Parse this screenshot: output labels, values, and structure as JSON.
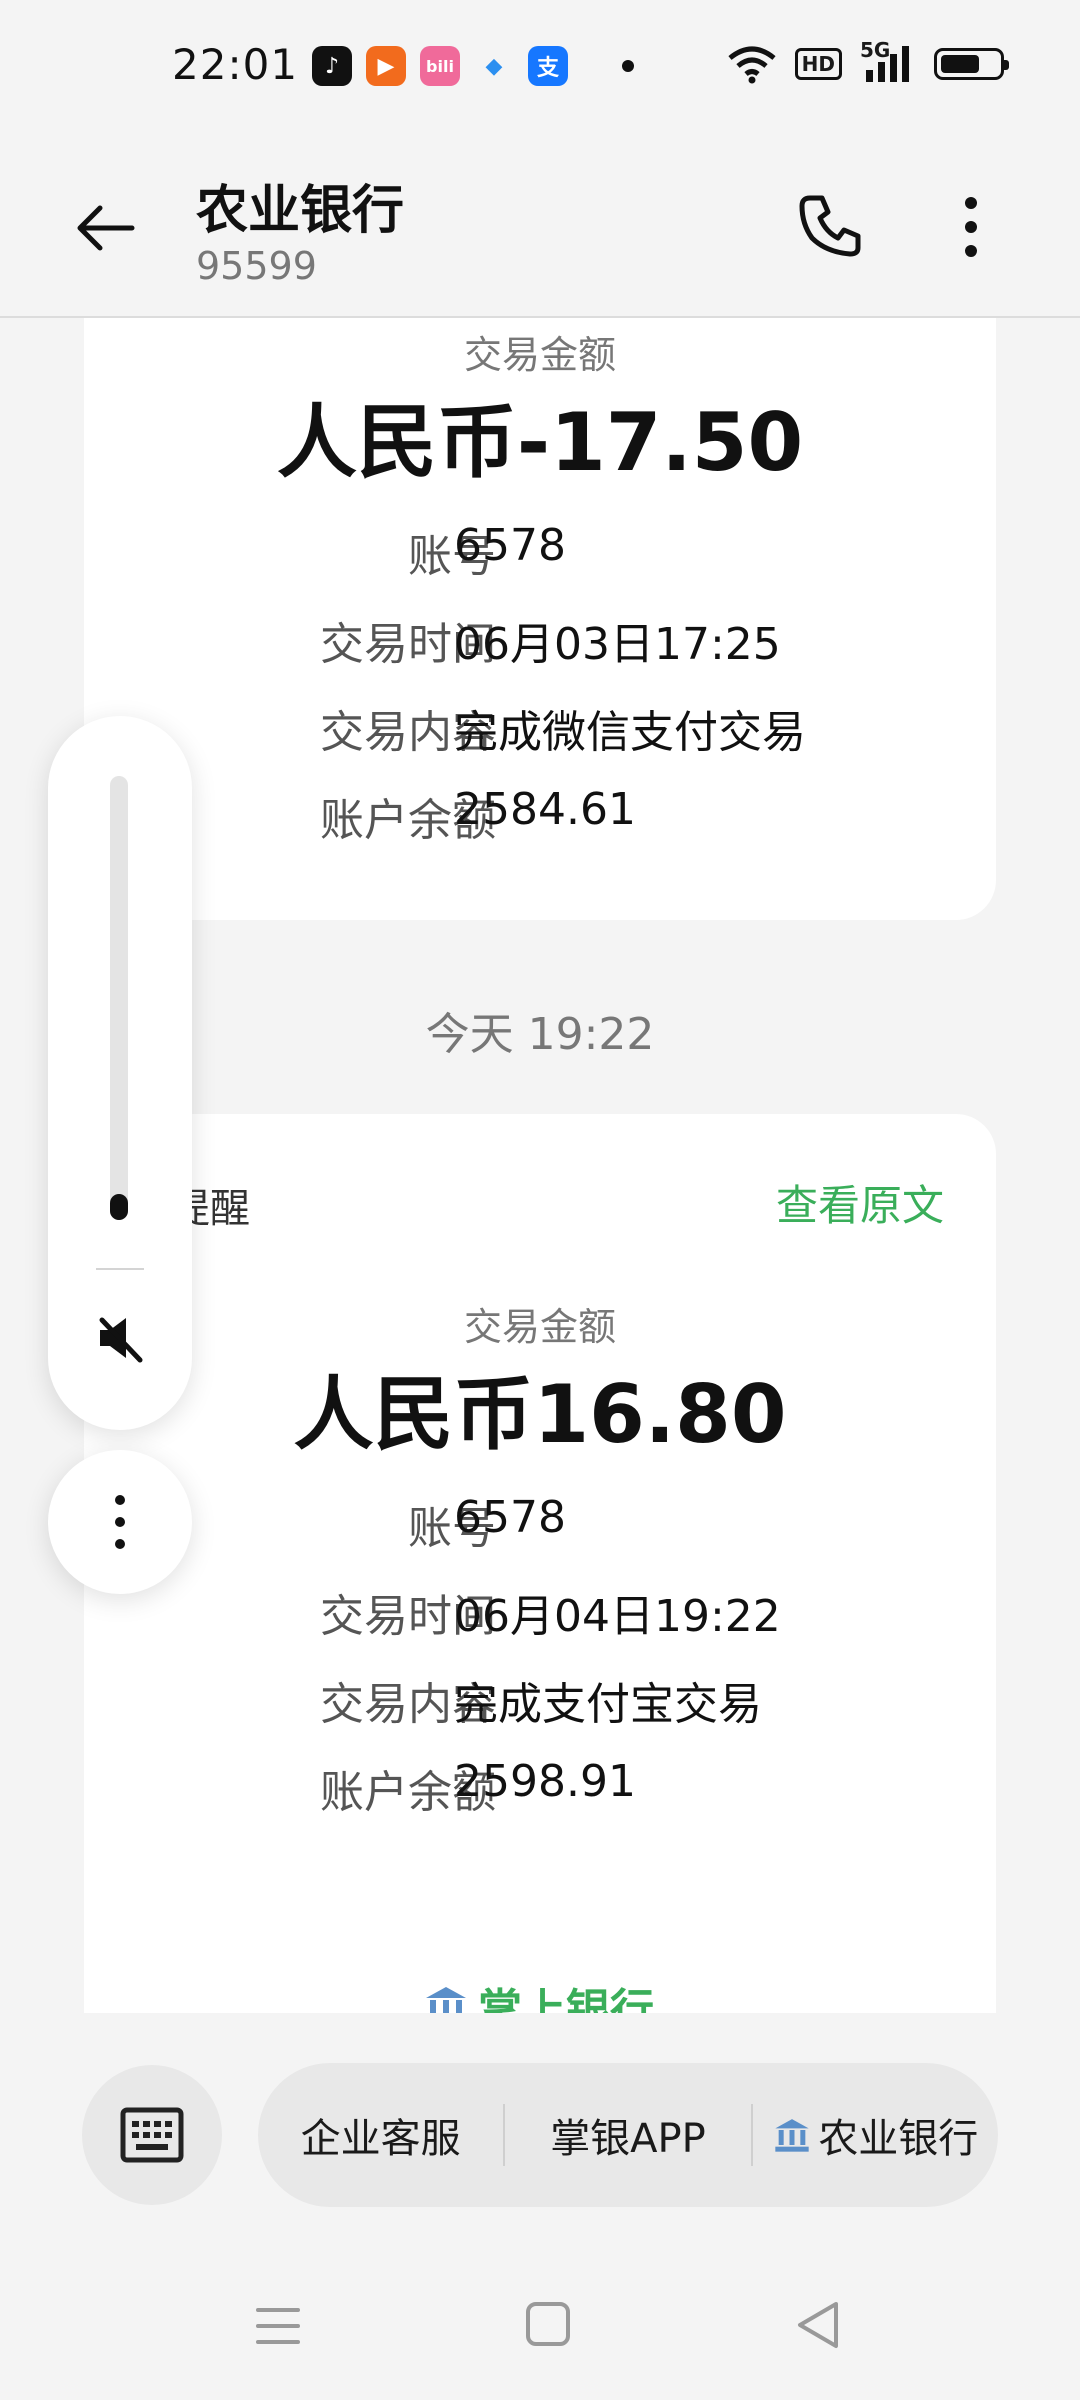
{
  "status_bar": {
    "time": "22:01",
    "app_icons": [
      "douyin-icon",
      "kuaishou-icon",
      "bilibili-icon",
      "feather-app-icon",
      "alipay-icon"
    ],
    "network": "5G",
    "hd": "HD"
  },
  "header": {
    "title": "农业银行",
    "subtitle": "95599"
  },
  "messages": [
    {
      "amount_label": "交易金额",
      "amount": "人民币-17.50",
      "rows": [
        {
          "key": "账号",
          "value": "6578"
        },
        {
          "key": "交易时间",
          "value": "06月03日17:25"
        },
        {
          "key": "交易内容",
          "value": "完成微信支付交易"
        },
        {
          "key": "账户余额",
          "value": "2584.61"
        }
      ]
    },
    {
      "header": "易提醒",
      "view_original": "查看原文",
      "amount_label": "交易金额",
      "amount": "人民币16.80",
      "rows": [
        {
          "key": "账号",
          "value": "6578"
        },
        {
          "key": "交易时间",
          "value": "06月04日19:22"
        },
        {
          "key": "交易内容",
          "value": "完成支付宝交易"
        },
        {
          "key": "账户余额",
          "value": "2598.91"
        }
      ],
      "bank_link": "掌上银行"
    }
  ],
  "timestamp": "今天 19:22",
  "bottom_menu": {
    "items": [
      "企业客服",
      "掌银APP",
      "农业银行"
    ]
  },
  "colors": {
    "accent_green": "#3aae5a",
    "background": "#f4f4f4",
    "card": "#ffffff"
  }
}
